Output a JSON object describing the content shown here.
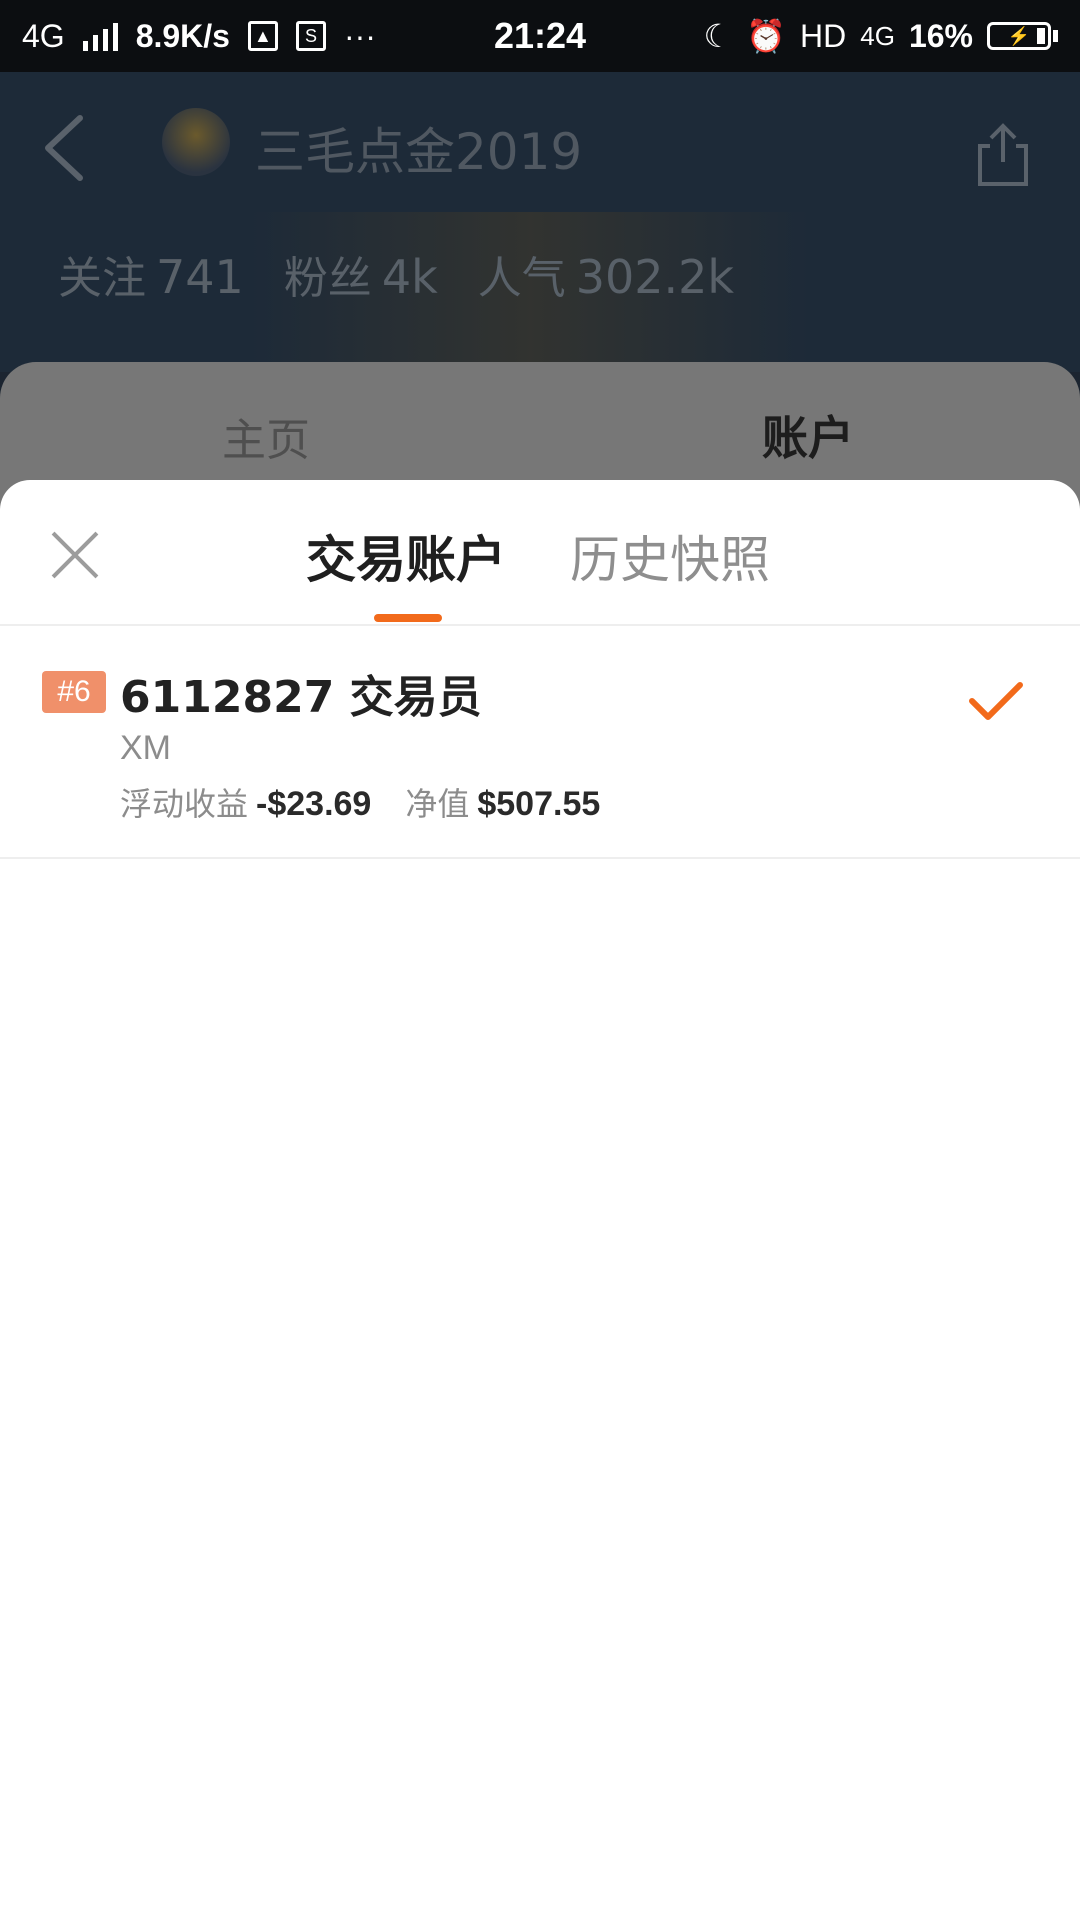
{
  "status_bar": {
    "network": "4G",
    "speed": "8.9K/s",
    "more": "···",
    "time": "21:24",
    "hd": "HD",
    "net2": "4G",
    "battery": "16%"
  },
  "profile": {
    "username": "三毛点金2019",
    "stats": [
      {
        "label": "关注",
        "value": "741"
      },
      {
        "label": "粉丝",
        "value": "4k"
      },
      {
        "label": "人气",
        "value": "302.2k"
      }
    ]
  },
  "page_tabs": {
    "home": "主页",
    "account": "账户"
  },
  "sheet": {
    "tabs": {
      "active": "交易账户",
      "inactive": "历史快照"
    },
    "account": {
      "rank": "#6",
      "title": "6112827 交易员",
      "broker": "XM",
      "floating_label": "浮动收益",
      "floating_value": "-$23.69",
      "equity_label": "净值",
      "equity_value": "$507.55"
    }
  },
  "colors": {
    "accent": "#f26a1b",
    "badge": "#f0906a"
  }
}
